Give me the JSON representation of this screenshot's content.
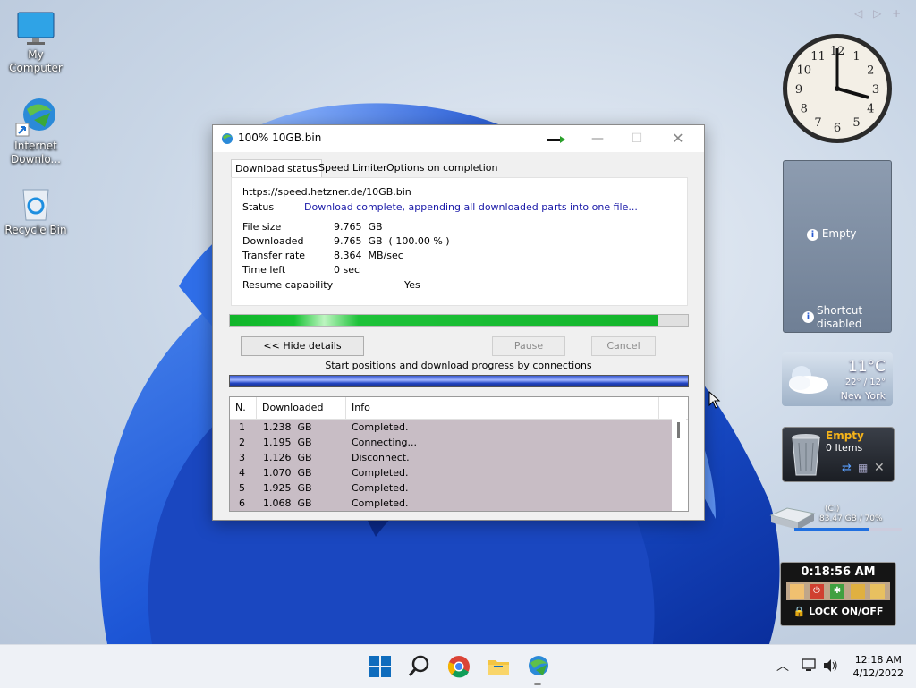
{
  "desktop": {
    "icons": [
      {
        "label": "My Computer",
        "icon": "monitor-icon"
      },
      {
        "label": "Internet Downlo...",
        "icon": "idm-globe-icon"
      },
      {
        "label": "Recycle Bin",
        "icon": "recycle-bin-icon"
      }
    ]
  },
  "window": {
    "title": "100% 10GB.bin",
    "tabs": [
      "Download status",
      "Speed Limiter",
      "Options on completion"
    ],
    "url": "https://speed.hetzner.de/10GB.bin",
    "status_label": "Status",
    "status_value": "Download complete, appending all downloaded parts into one file...",
    "status_color": "#1a1aa8",
    "rows": [
      {
        "label": "File size",
        "value": "9.765  GB"
      },
      {
        "label": "Downloaded",
        "value": "9.765  GB  ( 100.00 % )"
      },
      {
        "label": "Transfer rate",
        "value": "8.364  MB/sec"
      },
      {
        "label": "Time left",
        "value": "0 sec"
      }
    ],
    "resume_label": "Resume capability",
    "resume_value": "Yes",
    "progress_fraction": 0.935,
    "buttons": {
      "hide_details": "<< Hide details",
      "pause": "Pause",
      "cancel": "Cancel"
    },
    "connections_caption": "Start positions and download progress by connections",
    "table": {
      "headers": [
        "N.",
        "Downloaded",
        "Info"
      ],
      "rows": [
        {
          "n": "1",
          "downloaded": "1.238  GB",
          "info": "Completed."
        },
        {
          "n": "2",
          "downloaded": "1.195  GB",
          "info": "Connecting..."
        },
        {
          "n": "3",
          "downloaded": "1.126  GB",
          "info": "Disconnect."
        },
        {
          "n": "4",
          "downloaded": "1.070  GB",
          "info": "Completed."
        },
        {
          "n": "5",
          "downloaded": "1.925  GB",
          "info": "Completed."
        },
        {
          "n": "6",
          "downloaded": "1.068  GB",
          "info": "Completed."
        }
      ]
    }
  },
  "gadgets": {
    "clock_numbers": [
      "12",
      "1",
      "2",
      "3",
      "4",
      "5",
      "6",
      "7",
      "8",
      "9",
      "10",
      "11"
    ],
    "slideshow": {
      "empty": "Empty",
      "shortcut_line1": "Shortcut",
      "shortcut_line2": "disabled"
    },
    "weather": {
      "temp": "11°C",
      "range": "22° / 12°",
      "city": "New York"
    },
    "recycle": {
      "state": "Empty",
      "items": "0 Items"
    },
    "drive": {
      "name": "(C:)",
      "usage": "83.47 GB / 70%",
      "used_fraction": 0.7
    },
    "lock": {
      "time": "0:18:56 AM",
      "label": "LOCK ON/OFF"
    }
  },
  "taskbar": {
    "time": "12:18 AM",
    "date": "4/12/2022",
    "accent": "#0f6cbd"
  }
}
